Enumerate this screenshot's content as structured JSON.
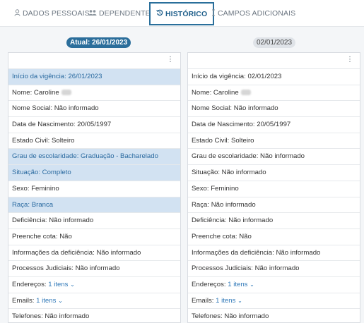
{
  "tabs": [
    {
      "label": "DADOS PESSOAIS",
      "icon": "person-icon"
    },
    {
      "label": "DEPENDENTES",
      "icon": "users-icon"
    },
    {
      "label": "HISTÓRICO",
      "icon": "history-icon",
      "active": true
    },
    {
      "label": "CAMPOS ADICIONAIS",
      "icon": "fields-icon"
    }
  ],
  "left_column": {
    "date_badge": "Atual: 26/01/2023",
    "rows": {
      "vigencia": "Início da vigência: 26/01/2023",
      "nome": "Nome: Caroline",
      "nome_social": "Nome Social: Não informado",
      "nascimento": "Data de Nascimento: 20/05/1997",
      "estado_civil": "Estado Civil: Solteiro",
      "escolaridade": "Grau de escolaridade: Graduação - Bacharelado",
      "situacao": "Situação: Completo",
      "sexo": "Sexo: Feminino",
      "raca": "Raça: Branca",
      "deficiencia": "Deficiência: Não informado",
      "cota": "Preenche cota: Não",
      "info_deficiencia": "Informações da deficiência: Não informado",
      "processos": "Processos Judiciais: Não informado",
      "enderecos_label": "Endereços:",
      "enderecos_link": "1 itens",
      "emails_label": "Emails:",
      "emails_link": "1 itens",
      "telefones": "Telefones: Não informado"
    }
  },
  "right_column": {
    "date_badge": "02/01/2023",
    "rows": {
      "vigencia": "Início da vigência: 02/01/2023",
      "nome": "Nome: Caroline",
      "nome_social": "Nome Social: Não informado",
      "nascimento": "Data de Nascimento: 20/05/1997",
      "estado_civil": "Estado Civil: Solteiro",
      "escolaridade": "Grau de escolaridade: Não informado",
      "situacao": "Situação: Não informado",
      "sexo": "Sexo: Feminino",
      "raca": "Raça: Não informado",
      "deficiencia": "Deficiência: Não informado",
      "cota": "Preenche cota: Não",
      "info_deficiencia": "Informações da deficiência: Não informado",
      "processos": "Processos Judiciais: Não informado",
      "enderecos_label": "Endereços:",
      "enderecos_link": "1 itens",
      "emails_label": "Emails:",
      "emails_link": "1 itens",
      "telefones": "Telefones: Não informado"
    }
  },
  "colors": {
    "accent": "#2b6e9b",
    "highlight_row": "#d2e2f2",
    "highlight_text": "#2a6aa0",
    "link": "#2f78b8"
  }
}
